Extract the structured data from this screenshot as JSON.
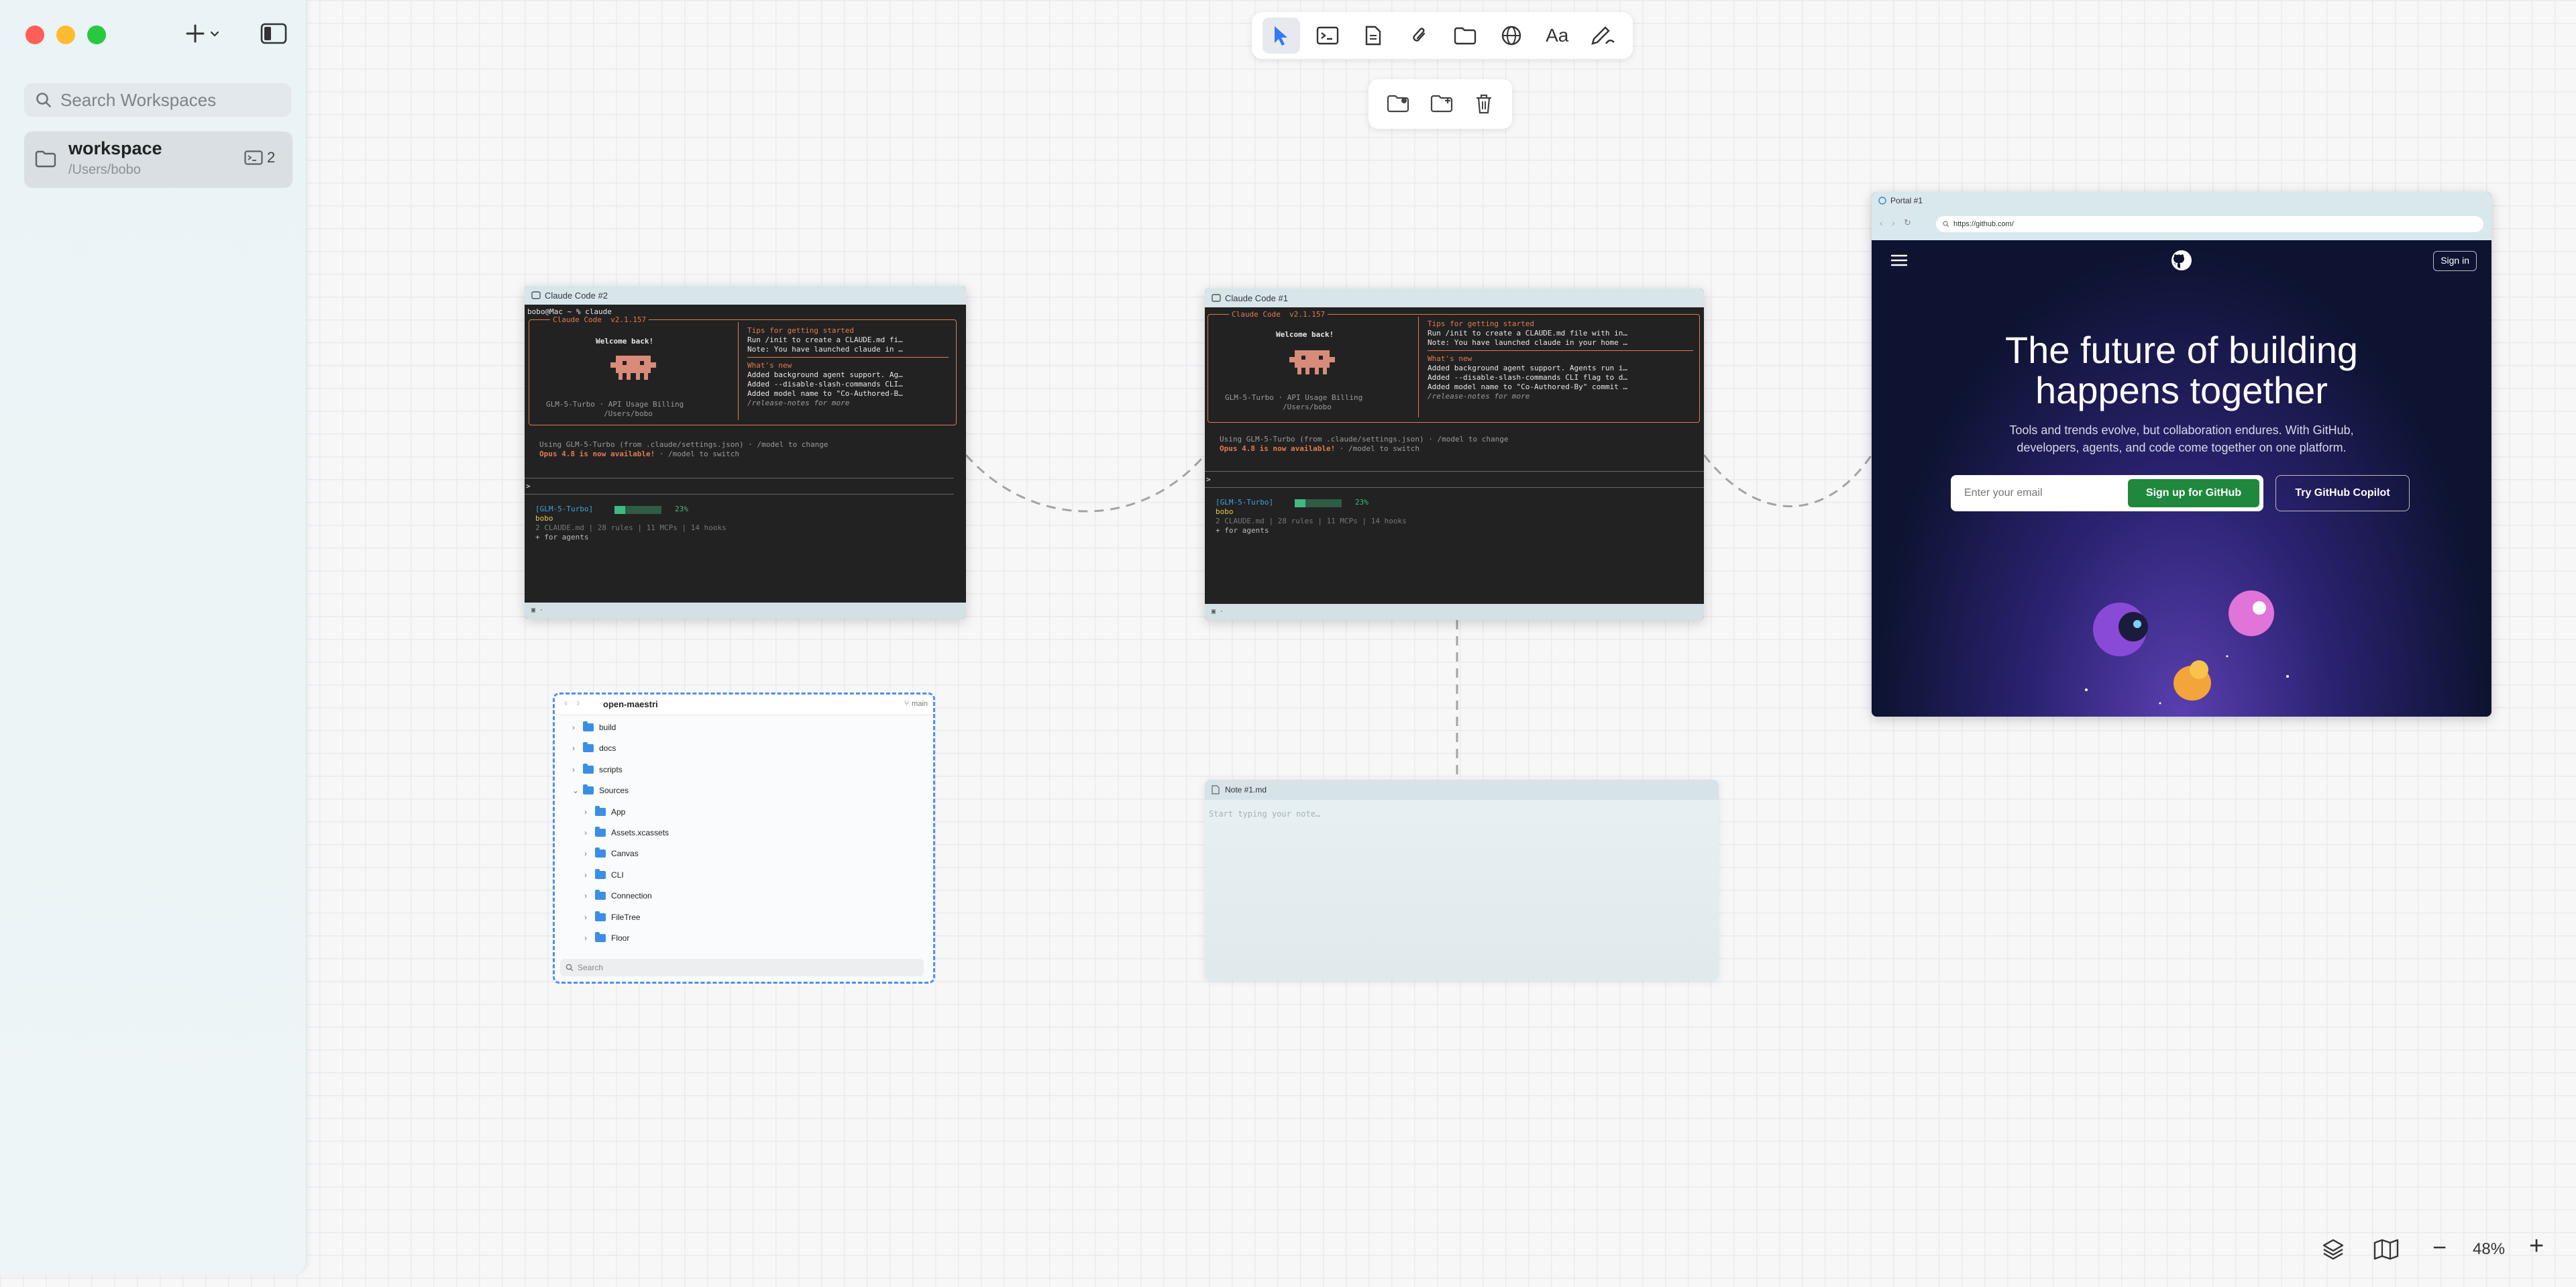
{
  "sidebar": {
    "search_placeholder": "Search Workspaces",
    "workspace": {
      "name": "workspace",
      "path": "/Users/bobo",
      "count": "2"
    }
  },
  "toolbar": {
    "tools": [
      "pointer-tool",
      "terminal-tool",
      "document-tool",
      "attachment-tool",
      "folder-tool",
      "web-tool",
      "text-tool",
      "draw-tool"
    ],
    "text_tool_label": "Aa"
  },
  "terminal2": {
    "title": "Claude Code #2",
    "prompt": "bobo@Mac ~ % claude",
    "header": "Claude Code  v2.1.157",
    "welcome": "Welcome back!",
    "model_line": "GLM-5-Turbo · API Usage Billing",
    "path": "/Users/bobo",
    "tips_title": "Tips for getting started",
    "tips_1": "Run /init to create a CLAUDE.md fi…",
    "tips_2": "Note: You have launched claude in …",
    "whats_new": "What's new",
    "new_1": "Added background agent support. Ag…",
    "new_2": "Added --disable-slash-commands CLI…",
    "new_3": "Added model name to \"Co-Authored-B…",
    "release_notes": "/release-notes for more",
    "using": "Using GLM-5-Turbo (from .claude/settings.json) · /model to change",
    "opus": "Opus 4.8 is now available!",
    "opus_hint": " · /model to switch",
    "caret": ">",
    "status_model": "[GLM-5-Turbo]",
    "status_pct": "23%",
    "user": "bobo",
    "stats": "2 CLAUDE.md | 28 rules | 11 MCPs | 14 hooks",
    "agents": "+ for agents",
    "footer": "▣ ·"
  },
  "terminal1": {
    "title": "Claude Code #1",
    "header": "Claude Code  v2.1.157",
    "welcome": "Welcome back!",
    "model_line": "GLM-5-Turbo · API Usage Billing",
    "path": "/Users/bobo",
    "tips_title": "Tips for getting started",
    "tips_1": "Run /init to create a CLAUDE.md file with in…",
    "tips_2": "Note: You have launched claude in your home …",
    "whats_new": "What's new",
    "new_1": "Added background agent support. Agents run i…",
    "new_2": "Added --disable-slash-commands CLI flag to d…",
    "new_3": "Added model name to \"Co-Authored-By\" commit …",
    "release_notes": "/release-notes for more",
    "using": "Using GLM-5-Turbo (from .claude/settings.json) · /model to change",
    "opus": "Opus 4.8 is now available!",
    "opus_hint": " · /model to switch",
    "caret": ">",
    "status_model": "[GLM-5-Turbo]",
    "status_pct": "23%",
    "user": "bobo",
    "stats": "2 CLAUDE.md | 28 rules | 11 MCPs | 14 hooks",
    "agents": "+ for agents",
    "footer": "▣ ·"
  },
  "filetree": {
    "repo": "open-maestri",
    "branch": "main",
    "items": [
      {
        "label": "build",
        "expanded": false
      },
      {
        "label": "docs",
        "expanded": false
      },
      {
        "label": "scripts",
        "expanded": false
      },
      {
        "label": "Sources",
        "expanded": true
      },
      {
        "label": "App",
        "expanded": false
      },
      {
        "label": "Assets.xcassets",
        "expanded": false
      },
      {
        "label": "Canvas",
        "expanded": false
      },
      {
        "label": "CLI",
        "expanded": false
      },
      {
        "label": "Connection",
        "expanded": false
      },
      {
        "label": "FileTree",
        "expanded": false
      },
      {
        "label": "Floor",
        "expanded": false
      }
    ],
    "search_placeholder": "Search"
  },
  "note": {
    "title": "Note #1.md",
    "placeholder": "Start typing your note…"
  },
  "portal": {
    "title": "Portal #1",
    "url": "https://github.com/",
    "sign_in": "Sign in",
    "headline_1": "The future of building",
    "headline_2": "happens together",
    "sub_1": "Tools and trends evolve, but collaboration endures. With GitHub,",
    "sub_2": "developers, agents, and code come together on one platform.",
    "email_placeholder": "Enter your email",
    "signup": "Sign up for GitHub",
    "copilot": "Try GitHub Copilot"
  },
  "zoom": {
    "minus": "−",
    "level": "48%",
    "plus": "+"
  },
  "colors": {
    "accent": "#2f7bf6",
    "github_green": "#1f883d",
    "terminal_orange": "#e07a52",
    "terminal_green": "#3fba80"
  }
}
